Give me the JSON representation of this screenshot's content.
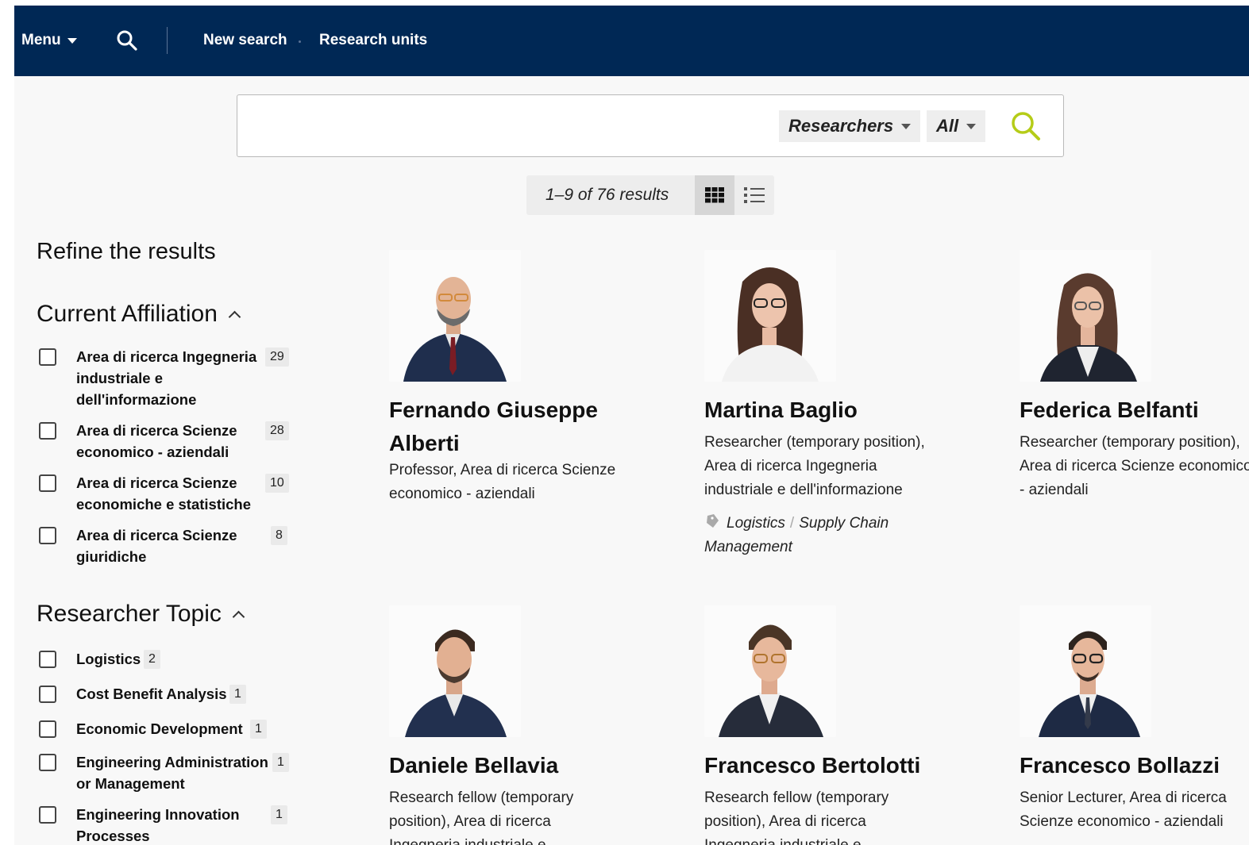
{
  "nav": {
    "menu_label": "Menu",
    "search_icon": "search-icon",
    "new_search_label": "New search",
    "research_units_label": "Research units"
  },
  "search": {
    "query_value": "",
    "type_selector": "Researchers",
    "scope_selector": "All"
  },
  "results": {
    "count_text": "1–9 of 76 results",
    "view_grid_icon": "grid-view-icon",
    "view_list_icon": "list-view-icon"
  },
  "sidebar": {
    "title": "Refine the results",
    "affiliation": {
      "title": "Current Affiliation",
      "items": [
        {
          "label_lines": [
            "Area di ricerca Ingegneria",
            "industriale e",
            "dell'informazione"
          ],
          "count": "29"
        },
        {
          "label_lines": [
            "Area di ricerca Scienze",
            "economico - aziendali"
          ],
          "count": "28"
        },
        {
          "label_lines": [
            "Area di ricerca Scienze",
            "economiche e statistiche"
          ],
          "count": "10"
        },
        {
          "label_lines": [
            "Area di ricerca Scienze",
            "giuridiche"
          ],
          "count": "8"
        }
      ]
    },
    "topic": {
      "title": "Researcher Topic",
      "items": [
        {
          "label_lines": [
            "Logistics"
          ],
          "count": "2"
        },
        {
          "label_lines": [
            "Cost Benefit Analysis"
          ],
          "count": "1"
        },
        {
          "label_lines": [
            "Economic Development"
          ],
          "count": "1"
        },
        {
          "label_lines": [
            "Engineering Administration",
            "or Management"
          ],
          "count": "1"
        },
        {
          "label_lines": [
            "Engineering Innovation",
            "Processes"
          ],
          "count": "1"
        }
      ]
    }
  },
  "researchers": [
    {
      "name_lines": [
        "Fernando Giuseppe",
        "Alberti"
      ],
      "role_lines": [
        "Professor, Area di ricerca Scienze",
        "economico - aziendali"
      ],
      "tags": []
    },
    {
      "name_lines": [
        "Martina Baglio"
      ],
      "role_lines": [
        "Researcher (temporary position),",
        "Area di ricerca Ingegneria",
        "industriale e dell'informazione"
      ],
      "tags": [
        "Logistics",
        "Supply Chain Management"
      ]
    },
    {
      "name_lines": [
        "Federica Belfanti"
      ],
      "role_lines": [
        "Researcher (temporary position),",
        "Area di ricerca Scienze economico",
        "- aziendali"
      ],
      "tags": []
    },
    {
      "name_lines": [
        "Daniele Bellavia"
      ],
      "role_lines": [
        "Research fellow (temporary",
        "position), Area di ricerca",
        "Ingegneria industriale e"
      ],
      "tags": []
    },
    {
      "name_lines": [
        "Francesco Bertolotti"
      ],
      "role_lines": [
        "Research fellow (temporary",
        "position), Area di ricerca",
        "Ingegneria industriale e"
      ],
      "tags": []
    },
    {
      "name_lines": [
        "Francesco Bollazzi"
      ],
      "role_lines": [
        "Senior Lecturer, Area di ricerca",
        "Scienze economico - aziendali"
      ],
      "tags": []
    }
  ],
  "colors": {
    "nav_bg": "#002855",
    "accent_search": "#b5cc18",
    "page_bg": "#f8f8f8"
  }
}
